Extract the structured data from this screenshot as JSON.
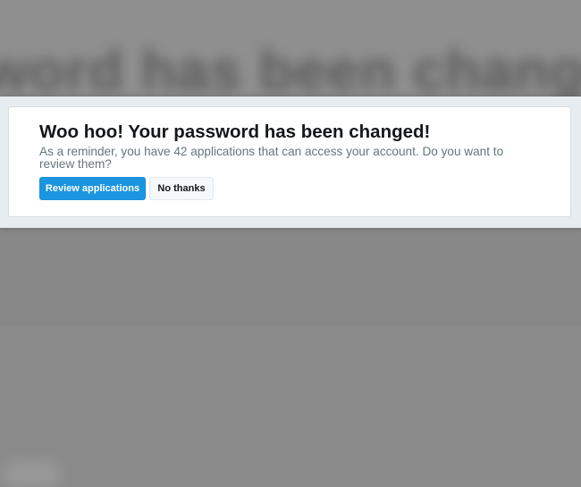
{
  "background": {
    "blurred_heading": "word has been changed!"
  },
  "dialog": {
    "title": "Woo hoo! Your password has been changed!",
    "message": "As a reminder, you have 42 applications that can access your account. Do you want to review them?",
    "primary_button_label": "Review applications",
    "secondary_button_label": "No thanks"
  },
  "colors": {
    "accent": "#1b95e0",
    "title_text": "#14171a",
    "message_text": "#66757f",
    "band_background": "#e6ecf0",
    "overlay_gray": "#8a8a8a"
  }
}
